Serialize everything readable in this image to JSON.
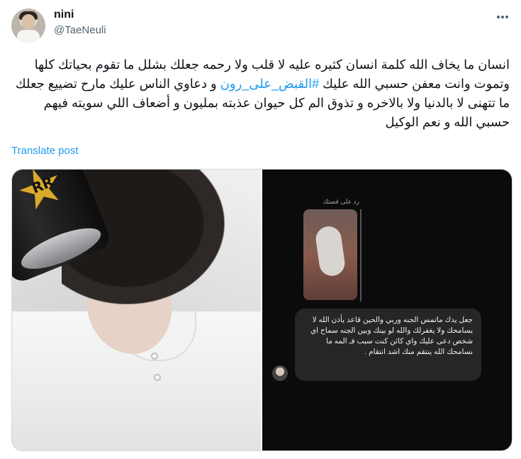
{
  "author": {
    "name": "nini",
    "handle": "@TaeNeuli"
  },
  "tweet": {
    "text_before_hashtag": "انسان ما يخاف الله كلمة انسان كثيره عليه لا قلب ولا رحمه جعلك بشلل ما تقوم بحياتك كلها وتموت وانت معفن حسبي الله عليك ",
    "hashtag": "#القبض_على_رون",
    "text_after_hashtag": " و دعاوي الناس عليك مارح تضييع جعلك ما تتهنى لا بالدنيا ولا بالاخره و تذوق الم كل حيوان عذبته بمليون و أضعاف اللي سويته فيهم حسبي الله و نعم الوكيل",
    "translate_label": "Translate post"
  },
  "media": {
    "right_image": {
      "reply_label": "رد على قصتك",
      "message": "جعل يدك ماتمس الجنه وربي والحين قاعد يأذن الله لا يسامحك ولا يغفرلك والله لو بينك وبين الجنه سماح اي شخص دعى عليك واي كائن كنت سبب فـ المه ما نسامحك الله ينتقم منك اشد انتقام ."
    }
  },
  "icons": {
    "more": "more-horizontal-icon"
  },
  "colors": {
    "link": "#1d9bf0",
    "secondary_text": "#536471",
    "primary_text": "#0f1419"
  }
}
